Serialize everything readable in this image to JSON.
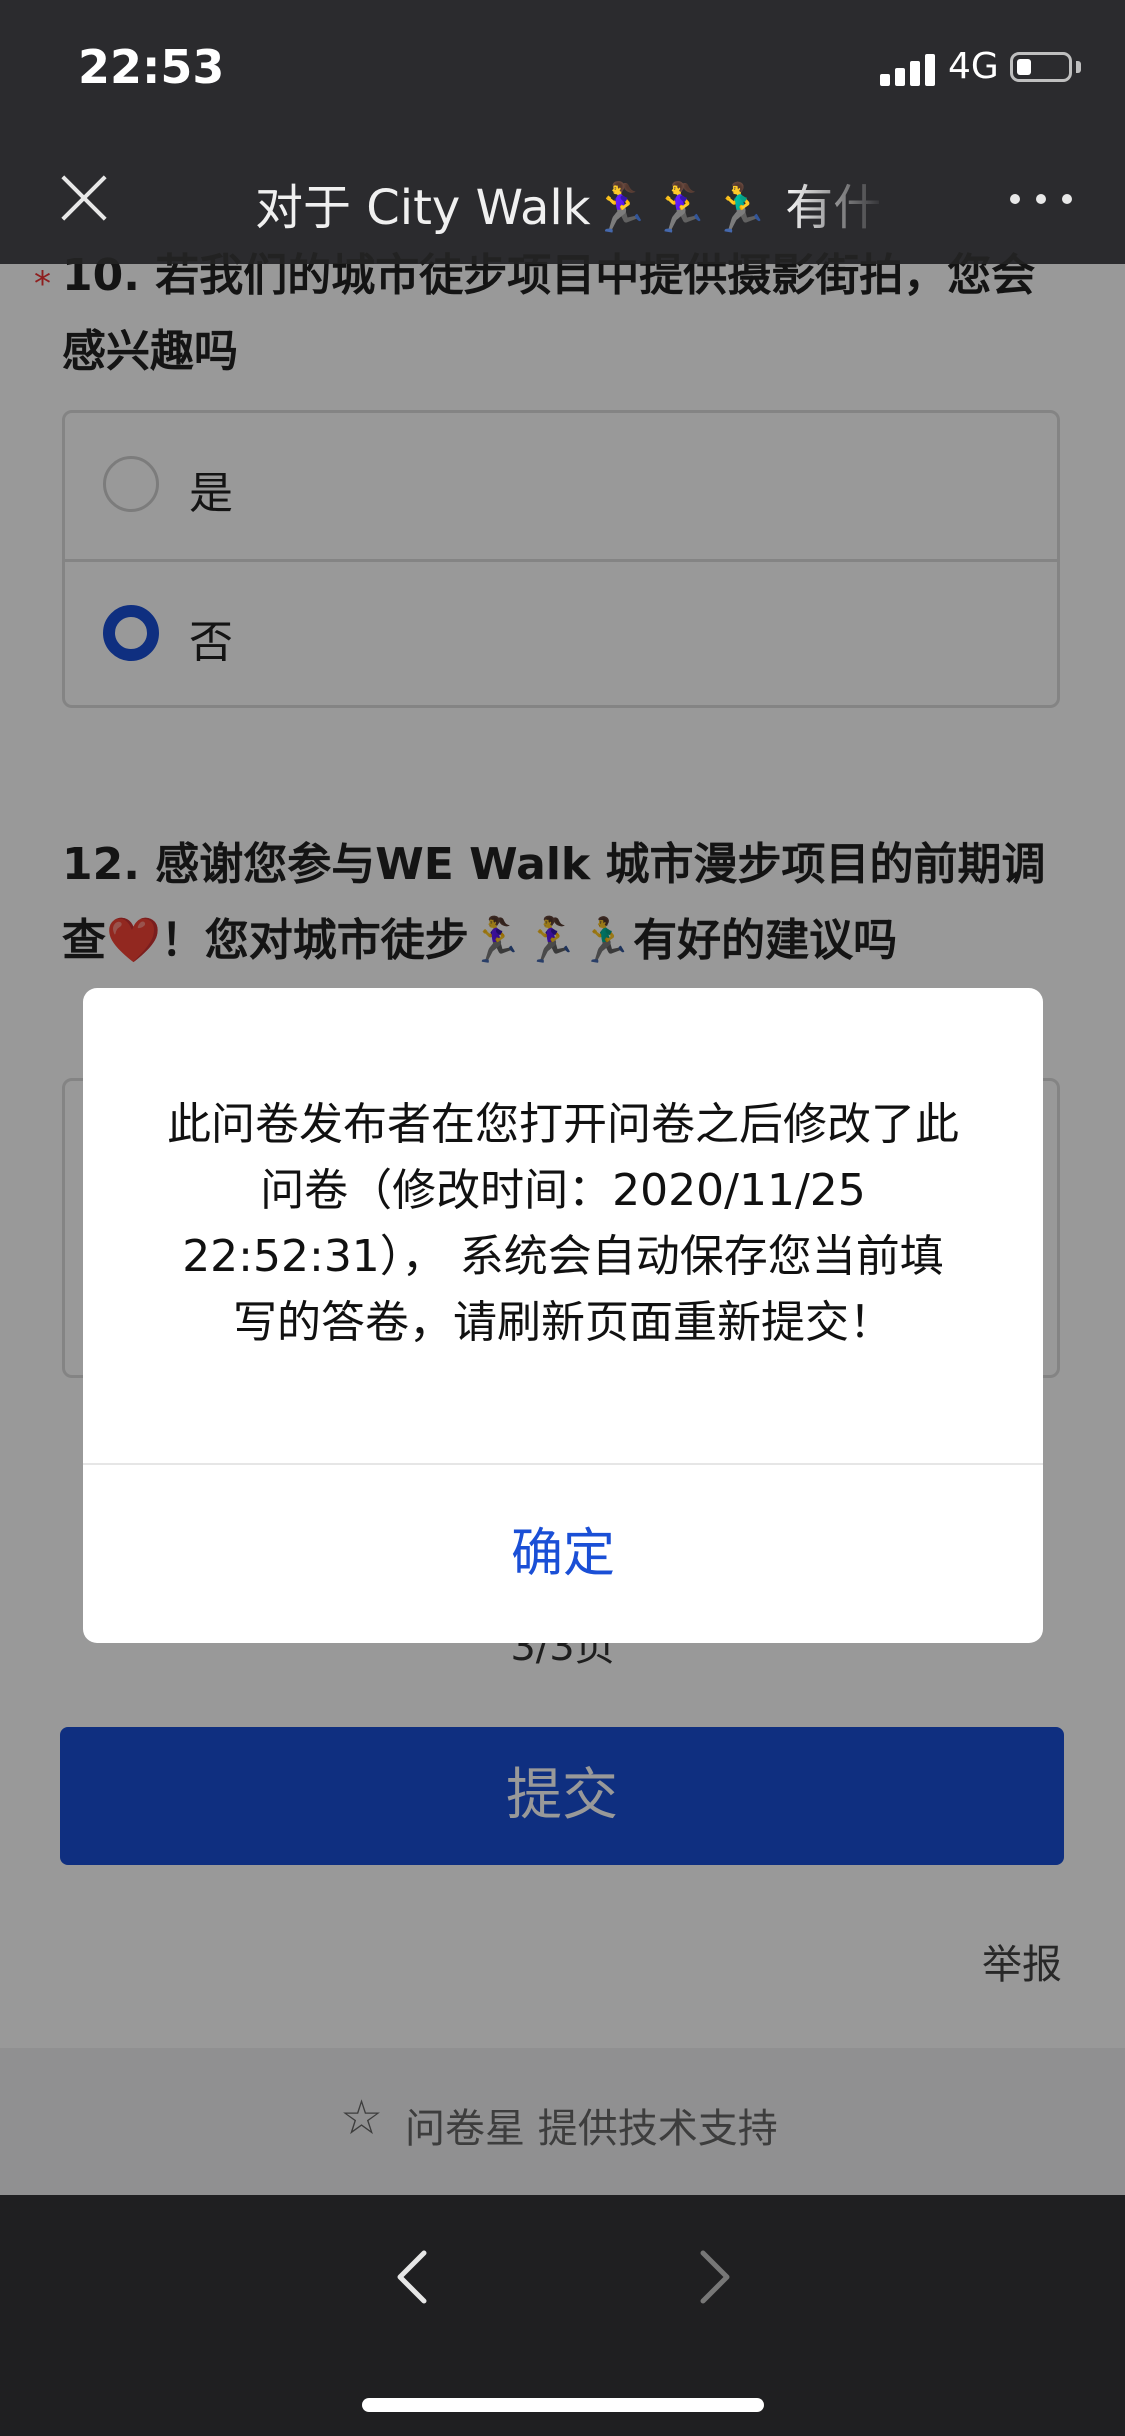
{
  "status_bar": {
    "time": "22:53",
    "network": "4G"
  },
  "nav": {
    "title": "对于 City Walk🏃‍♀️🏃‍♀️🏃‍♂️ 有什么想法"
  },
  "question10": {
    "text": "10. 若我们的城市徒步项目中提供摄影街拍，您会感兴趣吗",
    "options": [
      {
        "label": "是",
        "selected": false
      },
      {
        "label": "否",
        "selected": true
      }
    ]
  },
  "question12": {
    "text": "12. 感谢您参与WE Walk 城市漫步项目的前期调查❤️！您对城市徒步🏃‍♀️🏃‍♀️🏃‍♂️有好的建议吗"
  },
  "page_indicator": "3/3页",
  "submit_label": "提交",
  "report_label": "举报",
  "footer_text": "问卷星 提供技术支持",
  "dialog": {
    "message": "此问卷发布者在您打开问卷之后修改了此问卷（修改时间：2020/11/25 22:52:31），  系统会自动保存您当前填写的答卷，请刷新页面重新提交！",
    "confirm_label": "确定"
  },
  "colors": {
    "accent": "#1a4fd6",
    "nav_bg": "#2b2b2e",
    "bottom_bar_bg": "#1f1f21"
  },
  "icons": {
    "close": "close-icon",
    "more": "more-icon",
    "back": "chevron-left-icon",
    "forward": "chevron-right-icon",
    "footer": "star-icon"
  }
}
